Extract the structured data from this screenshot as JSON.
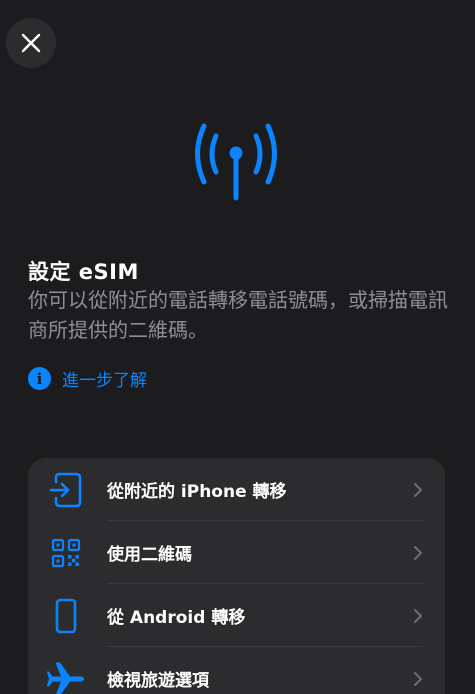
{
  "colors": {
    "accent": "#0a84ff",
    "background": "#1c1c1e",
    "card": "#2c2c2e",
    "secondary_text": "#8e8e93"
  },
  "header": {
    "close_icon": "close-icon"
  },
  "hero": {
    "icon": "antenna-signal-icon"
  },
  "setup": {
    "title": "設定 eSIM",
    "description": "你可以從附近的電話轉移電話號碼，或掃描電訊商所提供的二維碼。"
  },
  "learn_more": {
    "icon": "info-icon",
    "glyph": "i",
    "label": "進一步了解"
  },
  "options": [
    {
      "icon": "phone-transfer-icon",
      "label": "從附近的 iPhone 轉移"
    },
    {
      "icon": "qr-code-icon",
      "label": "使用二維碼"
    },
    {
      "icon": "android-phone-icon",
      "label": "從 Android 轉移"
    },
    {
      "icon": "airplane-icon",
      "label": "檢視旅遊選項"
    }
  ]
}
